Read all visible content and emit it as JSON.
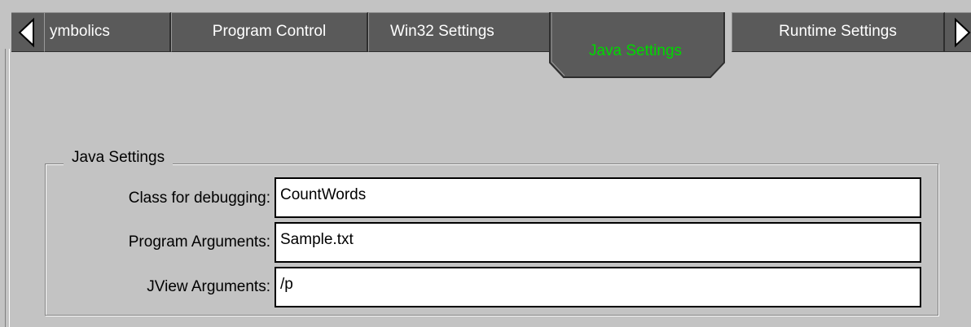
{
  "tabs": {
    "items": [
      {
        "label": "ymbolics"
      },
      {
        "label": "Program Control"
      },
      {
        "label": "Win32 Settings"
      },
      {
        "label": "Java Settings"
      },
      {
        "label": "Runtime Settings"
      }
    ],
    "active_label": "Java Settings",
    "active_color": "#00d800"
  },
  "icons": {
    "scroll_left": "triangle-left-icon",
    "scroll_right": "triangle-right-icon"
  },
  "group": {
    "title": "Java Settings",
    "fields": [
      {
        "label": "Class for debugging:",
        "value": "CountWords"
      },
      {
        "label": "Program Arguments:",
        "value": "Sample.txt"
      },
      {
        "label": "JView Arguments:",
        "value": "/p"
      }
    ]
  }
}
